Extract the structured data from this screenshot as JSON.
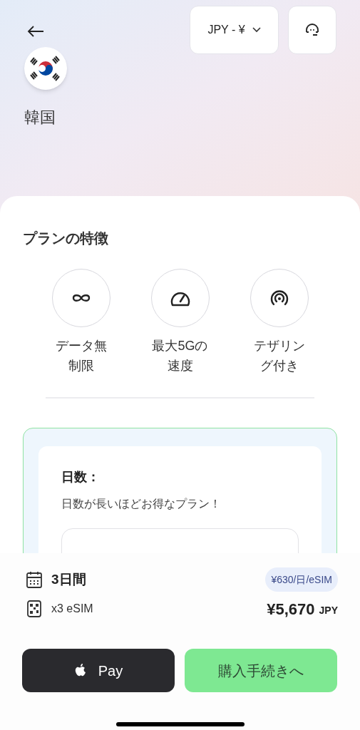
{
  "header": {
    "country": "韓国",
    "currency": "JPY - ¥"
  },
  "features": {
    "title": "プランの特徴",
    "items": [
      {
        "kind": "infinity",
        "label": "データ無制限"
      },
      {
        "kind": "speed",
        "label": "最大5Gの速度"
      },
      {
        "kind": "hotspot",
        "label": "テザリング付き"
      }
    ]
  },
  "days_card": {
    "title": "日数：",
    "subtitle": "日数が長いほどお得なプラン！"
  },
  "summary": {
    "duration": "3日間",
    "rate": "¥630/日/eSIM",
    "quantity": "x3 eSIM",
    "price": "¥5,670",
    "currency": "JPY"
  },
  "buttons": {
    "apple_pay": "Pay",
    "checkout": "購入手続きへ"
  }
}
